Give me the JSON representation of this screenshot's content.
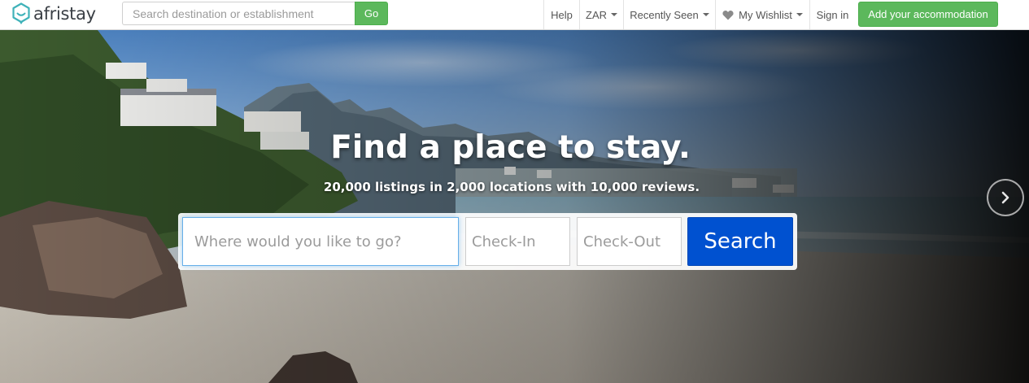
{
  "brand": {
    "name": "afristay",
    "accent": "#5cb85c",
    "logo_color": "#3fb2b9"
  },
  "nav_search": {
    "placeholder": "Search destination or establishment",
    "go_label": "Go"
  },
  "nav": {
    "help": "Help",
    "currency": "ZAR",
    "recently_seen": "Recently Seen",
    "wishlist": "My Wishlist",
    "sign_in": "Sign in",
    "add_accommodation": "Add your accommodation"
  },
  "hero": {
    "title": "Find a place to stay.",
    "subtitle": "20,000 listings in 2,000 locations with 10,000 reviews.",
    "where_placeholder": "Where would you like to go?",
    "checkin_placeholder": "Check-In",
    "checkout_placeholder": "Check-Out",
    "search_label": "Search",
    "search_button_color": "#0051d0"
  },
  "icons": {
    "logo": "afristay-logo-icon",
    "heart": "heart-icon",
    "caret": "caret-down-icon",
    "next": "chevron-right-icon"
  }
}
